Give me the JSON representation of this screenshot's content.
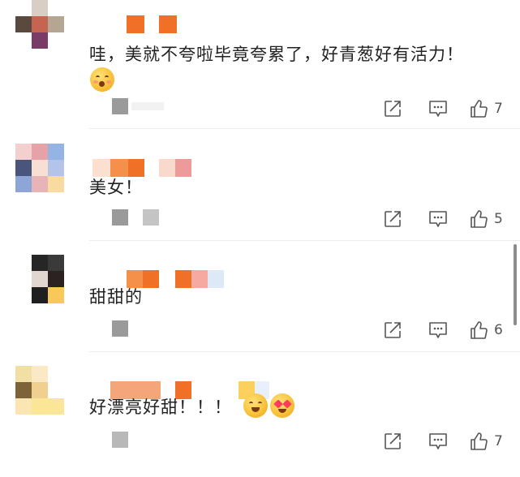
{
  "comments": [
    {
      "text": "哇，美就不夸啦毕竟夸累了，好青葱好有活力！",
      "like_count": "7",
      "emojis": [
        "flushed-face"
      ]
    },
    {
      "text": "美女！",
      "like_count": "5",
      "emojis": []
    },
    {
      "text": "甜甜的",
      "like_count": "6",
      "emojis": []
    },
    {
      "text": "好漂亮好甜！！！",
      "like_count": "7",
      "emojis": [
        "grinning-face",
        "smiling-face-with-hearts"
      ]
    }
  ],
  "icons": [
    "share-icon",
    "comment-icon",
    "thumbs-up-icon"
  ],
  "colors": {
    "text": "#222222",
    "icon": "#555555",
    "divider": "#ececec",
    "pixel_orange": "#f07028"
  }
}
